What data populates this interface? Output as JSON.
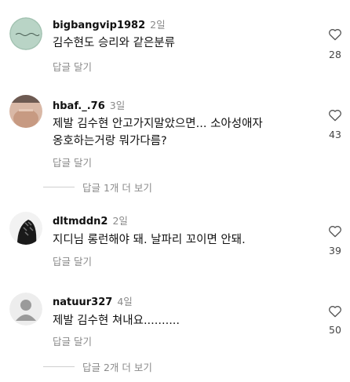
{
  "comments": [
    {
      "username": "bigbangvip1982",
      "time": "2일",
      "text": "김수현도 승리와 같은분류",
      "reply_label": "답글 달기",
      "likes": "28"
    },
    {
      "username": "hbaf._.76",
      "time": "3일",
      "text_line1": "제발 김수현 안고가지말았으면... 소아성애자",
      "text_line2": "옹호하는거랑 뭐가다름?",
      "reply_label": "답글 달기",
      "likes": "43",
      "view_replies": "답글 1개 더 보기"
    },
    {
      "username": "dltmddn2",
      "time": "2일",
      "text": "지디님 롱런해야 돼. 날파리 꼬이면 안돼.",
      "reply_label": "답글 달기",
      "likes": "39"
    },
    {
      "username": "natuur327",
      "time": "4일",
      "text": "제발 김수현 쳐내요..........",
      "reply_label": "답글 달기",
      "likes": "50",
      "view_replies": "답글 2개 더 보기"
    }
  ],
  "colors": {
    "text": "#111111",
    "secondary": "#8a8a8a",
    "divider": "#cfcfcf"
  },
  "icons": {
    "like": "heart-outline-icon",
    "default_avatar": "default-avatar-icon"
  }
}
